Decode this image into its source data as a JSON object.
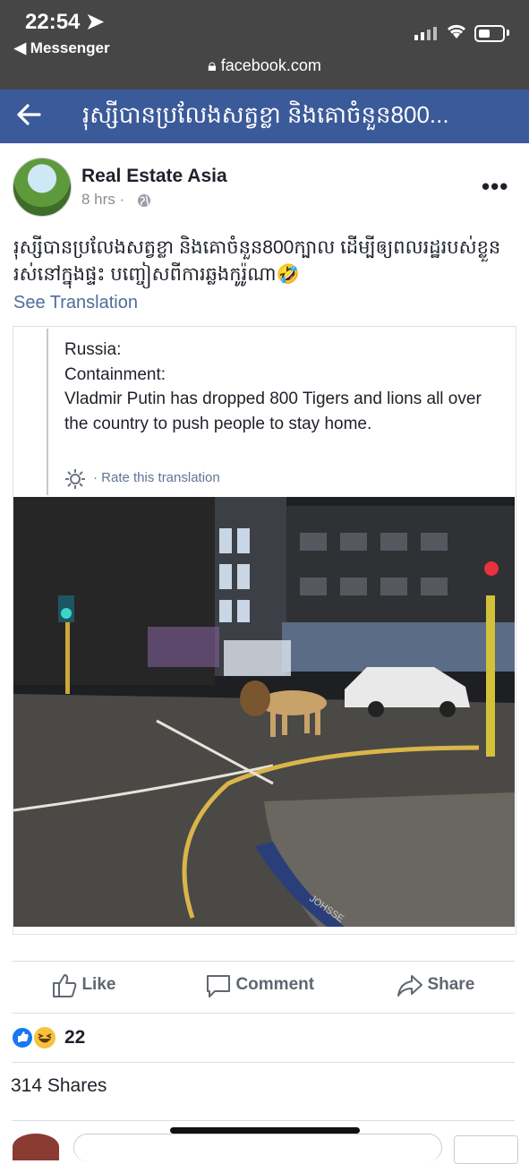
{
  "status_bar": {
    "time": "22:54",
    "back_app": "◀ Messenger",
    "url": "facebook.com"
  },
  "header": {
    "title": "រុស្សីបានប្រលែងសត្វខ្លា និងគោចំនួន800..."
  },
  "post": {
    "author": "Real Estate Asia",
    "time": "8 hrs ·",
    "text": "រុស្សីបានប្រលែងសត្វខ្លា និងគោចំនួន800ក្បាល ដើម្បីឲ្យពលរដ្ឋរបស់ខ្លួនរស់នៅក្នុងផ្ទះ បញ្ចៀសពីការឆ្លងកូរ៉ូណា🤣",
    "see_translation": "See Translation"
  },
  "embedded": {
    "quote_lines": [
      "Russia:",
      "Containment:",
      "Vladmir Putin has dropped 800 Tigers and lions all over the country to push people to stay home."
    ],
    "rate": "· Rate this translation",
    "street_sign": "JOHSSE"
  },
  "actions": {
    "like": "Like",
    "comment": "Comment",
    "share": "Share"
  },
  "stats": {
    "reactions": "22",
    "shares": "314 Shares"
  },
  "colors": {
    "fb_blue": "#3b5a9a",
    "status_bg": "#464646",
    "link": "#4f6d9a"
  }
}
